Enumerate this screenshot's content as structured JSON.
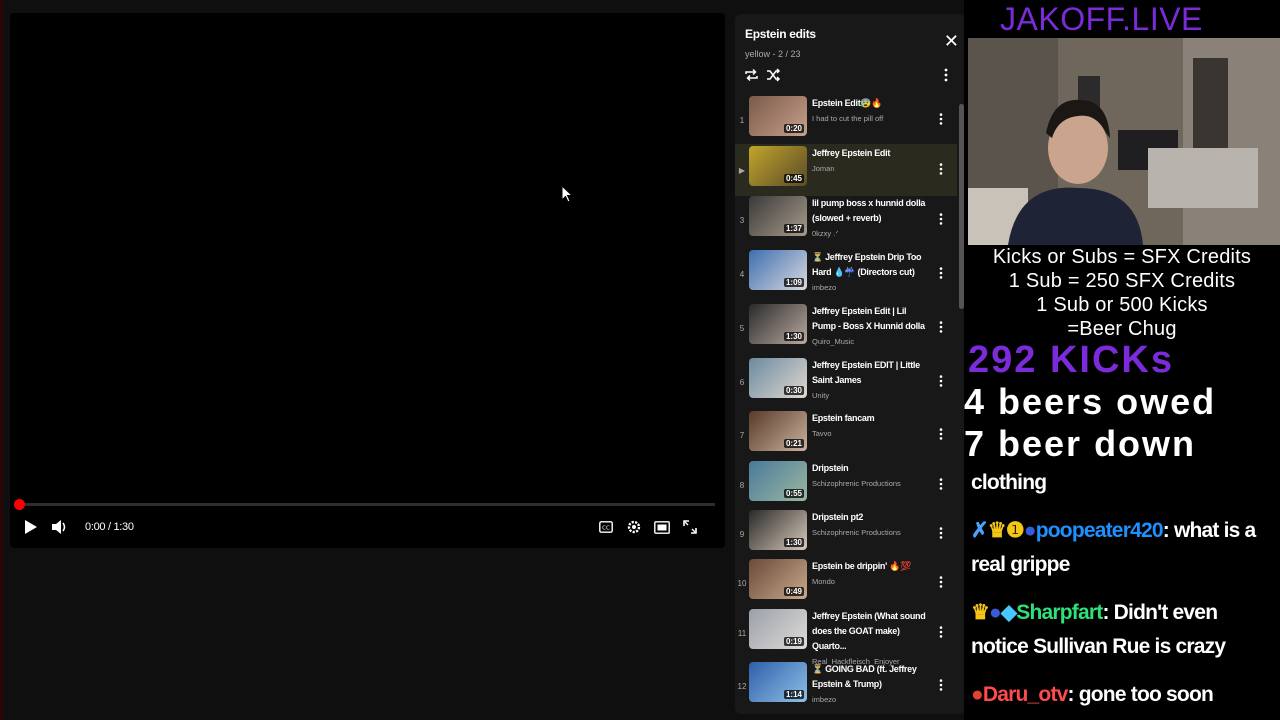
{
  "player": {
    "time": "0:00 / 1:30",
    "progress_fraction": 0,
    "icons": {
      "play": "play-icon",
      "volume": "volume-icon",
      "captions": "captions-icon",
      "settings": "settings-icon",
      "theater": "theater-icon",
      "fullscreen": "fullscreen-icon"
    }
  },
  "playlist": {
    "title": "Epstein edits",
    "subtitle": "yellow - 2 / 23",
    "items": [
      {
        "index": "1",
        "title": "Epstein Edit😰🔥",
        "channel": "I had to cut the pill off",
        "duration": "0:20"
      },
      {
        "index": "▶",
        "title": "Jeffrey Epstein Edit",
        "channel": "Joman",
        "duration": "0:45"
      },
      {
        "index": "3",
        "title": "lil pump boss x hunnid dolla (slowed + reverb)",
        "channel": "0kzxy .ᐟ",
        "duration": "1:37"
      },
      {
        "index": "4",
        "title": "⏳ Jeffrey Epstein Drip Too Hard 💧☔ (Directors cut)",
        "channel": "imbezo",
        "duration": "1:09"
      },
      {
        "index": "5",
        "title": "Jeffrey Epstein Edit | Lil Pump - Boss X Hunnid dolla",
        "channel": "Quiro_Music",
        "duration": "1:30"
      },
      {
        "index": "6",
        "title": "Jeffrey Epstein EDIT | Little Saint James",
        "channel": "Unity",
        "duration": "0:30"
      },
      {
        "index": "7",
        "title": "Epstein fancam",
        "channel": "Tavvo",
        "duration": "0:21"
      },
      {
        "index": "8",
        "title": "Dripstein",
        "channel": "Schizophrenic Productions",
        "duration": "0:55"
      },
      {
        "index": "9",
        "title": "Dripstein pt2",
        "channel": "Schizophrenic Productions",
        "duration": "1:30"
      },
      {
        "index": "10",
        "title": "Epstein be drippin' 🔥💯",
        "channel": "Mondo",
        "duration": "0:49"
      },
      {
        "index": "11",
        "title": "Jeffrey Epstein (What sound does the GOAT make) Quarto...",
        "channel": "Real_Hackfleisch_Enjoyer",
        "duration": "0:19"
      },
      {
        "index": "12",
        "title": "⏳ GOING BAD (ft. Jeffrey Epstein & Trump)",
        "channel": "imbezo",
        "duration": "1:14"
      }
    ]
  },
  "overlay": {
    "title": "JAKOFF.LIVE",
    "info": [
      "Kicks or Subs = SFX Credits",
      "1 Sub = 250 SFX Credits",
      "1 Sub or 500 Kicks",
      "=Beer Chug"
    ],
    "kicks": "292 KICKs",
    "beers_owed": "4 beers owed",
    "beers_down": "7 beer down",
    "chat": [
      {
        "user": "",
        "message": "clothing"
      },
      {
        "user": "poopeater420",
        "message": " what is a real grippe"
      },
      {
        "user": "Sharpfart",
        "message": " Didn't even notice Sullivan Rue is crazy"
      },
      {
        "user": "Daru_otv",
        "message": " gone too soon"
      }
    ]
  }
}
